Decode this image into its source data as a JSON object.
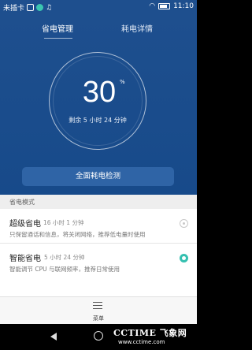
{
  "status_bar": {
    "carrier": "未插卡",
    "time": "11:10"
  },
  "tabs": [
    {
      "label": "省电管理"
    },
    {
      "label": "耗电详情"
    }
  ],
  "battery": {
    "percent": "30",
    "percent_sign": "%",
    "remaining": "剩余 5 小时 24 分钟"
  },
  "check_button": "全面耗电检测",
  "section_title": "省电模式",
  "modes": [
    {
      "title": "超级省电",
      "time": "16 小时 1 分钟",
      "desc": "只保留通话和信息，将关闭网络，推荐低电量时使用",
      "selected": false
    },
    {
      "title": "智能省电",
      "time": "5 小时 24 分钟",
      "desc": "智能调节 CPU 与联网频率，推荐日常使用",
      "selected": true
    }
  ],
  "menu": {
    "label": "菜单"
  },
  "watermark": {
    "brand": "CCTIME 飞象网",
    "url": "www.cctime.com"
  },
  "colors": {
    "header": "#1e4f8e",
    "accent": "#35c0b0"
  }
}
